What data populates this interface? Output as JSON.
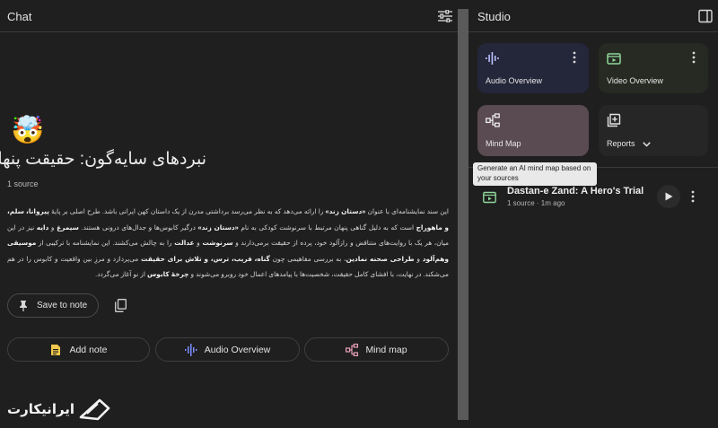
{
  "chat": {
    "title": "Chat",
    "emoji": "🤯",
    "source_title": "نبردهای سایه‌گون: حقیقت پنهان",
    "source_count": "1 source",
    "summary_html": "این سند نمایشنامه‌ای با عنوان <b>«دستان زند»</b> را ارائه می‌دهد که به نظر می‌رسد برداشتی مدرن از یک داستان کهن ایرانی باشد. طرح اصلی بر پایهٔ <b>پیروانا، سلم، و ماهوراج</b> است که به دلیل گناهی پنهان مرتبط با سرنوشت کودکی به نام <b>«دستان زند»</b> درگیر کابوس‌ها و جدال‌های درونی هستند. <b>سیمرغ</b> و <b>دایه</b> نیز در این میان، هر یک با روایت‌های متناقض و رازآلود خود، پرده از حقیقت برمی‌دارند و <b>سرنوشت</b> و <b>عدالت</b> را به چالش می‌کشند. این نمایشنامه با ترکیبی از <b>موسیقی وهم‌آلود</b> و <b>طراحی صحنه نمادین</b>، به بررسی مفاهیمی چون <b>گناه، فریب، ترس، و تلاش برای حقیقت</b> می‌پردازد و مرزِ بین واقعیت و کابوس را در هم می‌شکند. در نهایت، با افشای کامل حقیقت، شخصیت‌ها با پیامدهای اعمال خود روبرو می‌شوند و <b>چرخهٔ کابوس</b> از نو آغاز می‌گردد.",
    "save_label": "Save to note",
    "actions": {
      "add_note": "Add note",
      "audio_overview": "Audio Overview",
      "mind_map": "Mind map"
    },
    "watermark": "ایرانیکارت"
  },
  "studio": {
    "title": "Studio",
    "cards": {
      "audio": "Audio Overview",
      "video": "Video Overview",
      "mind": "Mind Map",
      "reports": "Reports"
    },
    "tooltip": "Generate an AI mind map based on your sources",
    "note": {
      "title": "Dastan-e Zand: A Hero's Trial",
      "meta": "1 source · 1m ago"
    }
  },
  "colors": {
    "background": "#1f1f1f",
    "audio_card": "#24263a",
    "video_card": "#262a22",
    "mind_card": "#5a4a52",
    "accent_blue": "#7b8cff",
    "accent_green": "#6fcf7f",
    "accent_yellow": "#f2c94c"
  },
  "icons": [
    "tune-icon",
    "pin-icon",
    "copy-icon",
    "note-icon",
    "audio-wave-icon",
    "mind-map-icon",
    "video-icon",
    "report-icon",
    "more-vert-icon",
    "play-icon",
    "panel-toggle-icon"
  ]
}
